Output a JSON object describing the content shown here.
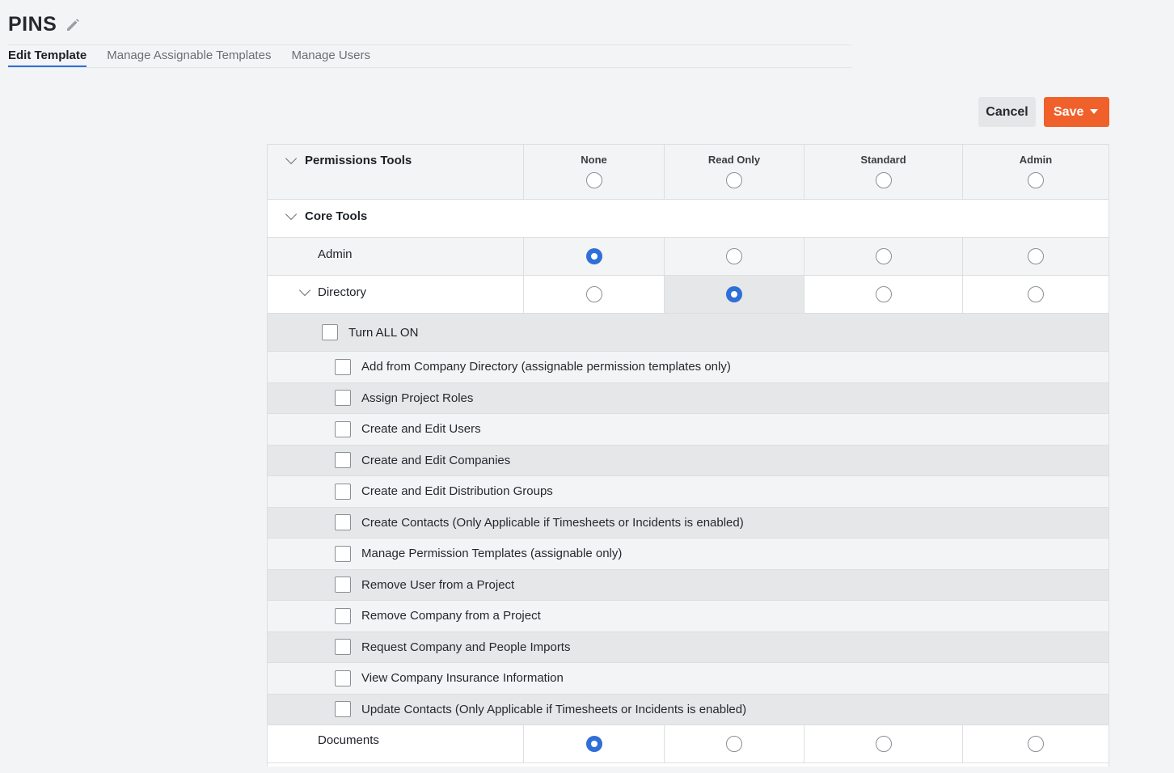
{
  "header": {
    "title": "PINS",
    "tabs": [
      {
        "label": "Edit Template"
      },
      {
        "label": "Manage Assignable Templates"
      },
      {
        "label": "Manage Users"
      }
    ]
  },
  "actions": {
    "cancel_label": "Cancel",
    "save_label": "Save"
  },
  "table": {
    "tools_header": "Permissions Tools",
    "columns": [
      "None",
      "Read Only",
      "Standard",
      "Admin"
    ],
    "section_title": "Core Tools",
    "tools": {
      "admin": {
        "label": "Admin",
        "selected": "None"
      },
      "directory": {
        "label": "Directory",
        "selected": "Read Only",
        "turn_all_on_label": "Turn ALL ON",
        "permissions": [
          "Add from Company Directory (assignable permission templates only)",
          "Assign Project Roles",
          "Create and Edit Users",
          "Create and Edit Companies",
          "Create and Edit Distribution Groups",
          "Create Contacts (Only Applicable if Timesheets or Incidents is enabled)",
          "Manage Permission Templates (assignable only)",
          "Remove User from a Project",
          "Remove Company from a Project",
          "Request Company and People Imports",
          "View Company Insurance Information",
          "Update Contacts (Only Applicable if Timesheets or Incidents is enabled)"
        ]
      },
      "documents": {
        "label": "Documents",
        "selected": "None"
      }
    }
  },
  "icons": {
    "edit": "pencil-icon",
    "collapse": "chevron-down-icon",
    "dropdown": "caret-down-icon"
  },
  "colors": {
    "accent": "#2e6fd8",
    "save": "#f0602b"
  }
}
